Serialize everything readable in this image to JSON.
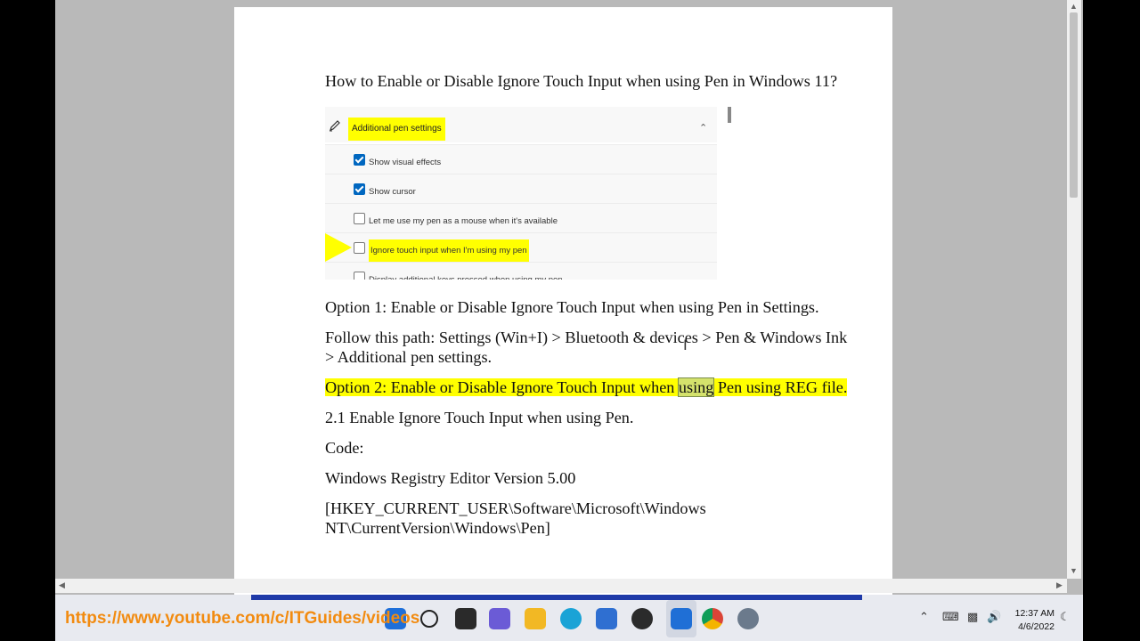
{
  "document": {
    "title": "How to Enable or Disable Ignore Touch Input when using Pen in Windows 11?",
    "option1": "Option 1: Enable or Disable Ignore Touch Input when using Pen in Settings.",
    "path": "Follow this path: Settings (Win+I) > Bluetooth & devices > Pen & Windows Ink > Additional pen settings.",
    "option2_pre": "Option 2: Enable or Disable Ignore Touch Input when ",
    "option2_sel": "using",
    "option2_post": " Pen using REG file.",
    "enable_heading": "2.1 Enable Ignore Touch Input when using Pen.",
    "code_label": "Code:",
    "reg_version": "Windows Registry Editor Version 5.00",
    "reg_key": "[HKEY_CURRENT_USER\\Software\\Microsoft\\Windows NT\\CurrentVersion\\Windows\\Pen]"
  },
  "screenshot": {
    "header": "Additional pen settings",
    "rows": [
      {
        "label": "Show visual effects",
        "checked": true
      },
      {
        "label": "Show cursor",
        "checked": true
      },
      {
        "label": "Let me use my pen as a mouse when it's available",
        "checked": false
      },
      {
        "label": "Ignore touch input when I'm using my pen",
        "checked": false,
        "highlight": true
      },
      {
        "label": "Display additional keys pressed when using my pen",
        "checked": false
      }
    ]
  },
  "watermark": {
    "url": "https://www.youtube.com/c/ITGuides/videos"
  },
  "taskbar": {
    "apps": [
      "start-icon",
      "search-icon",
      "task-view-icon",
      "chat-icon",
      "file-explorer-icon",
      "edge-icon",
      "store-icon",
      "media-player-icon",
      "active-app-icon",
      "chrome-icon",
      "settings-icon"
    ],
    "clock": {
      "time": "12:37 AM",
      "date": "4/6/2022"
    }
  },
  "colors": {
    "highlight": "#ffff00",
    "watermark": "#f28b10",
    "taskbar": "#e8eaf0",
    "checkbox": "#0067c0"
  }
}
